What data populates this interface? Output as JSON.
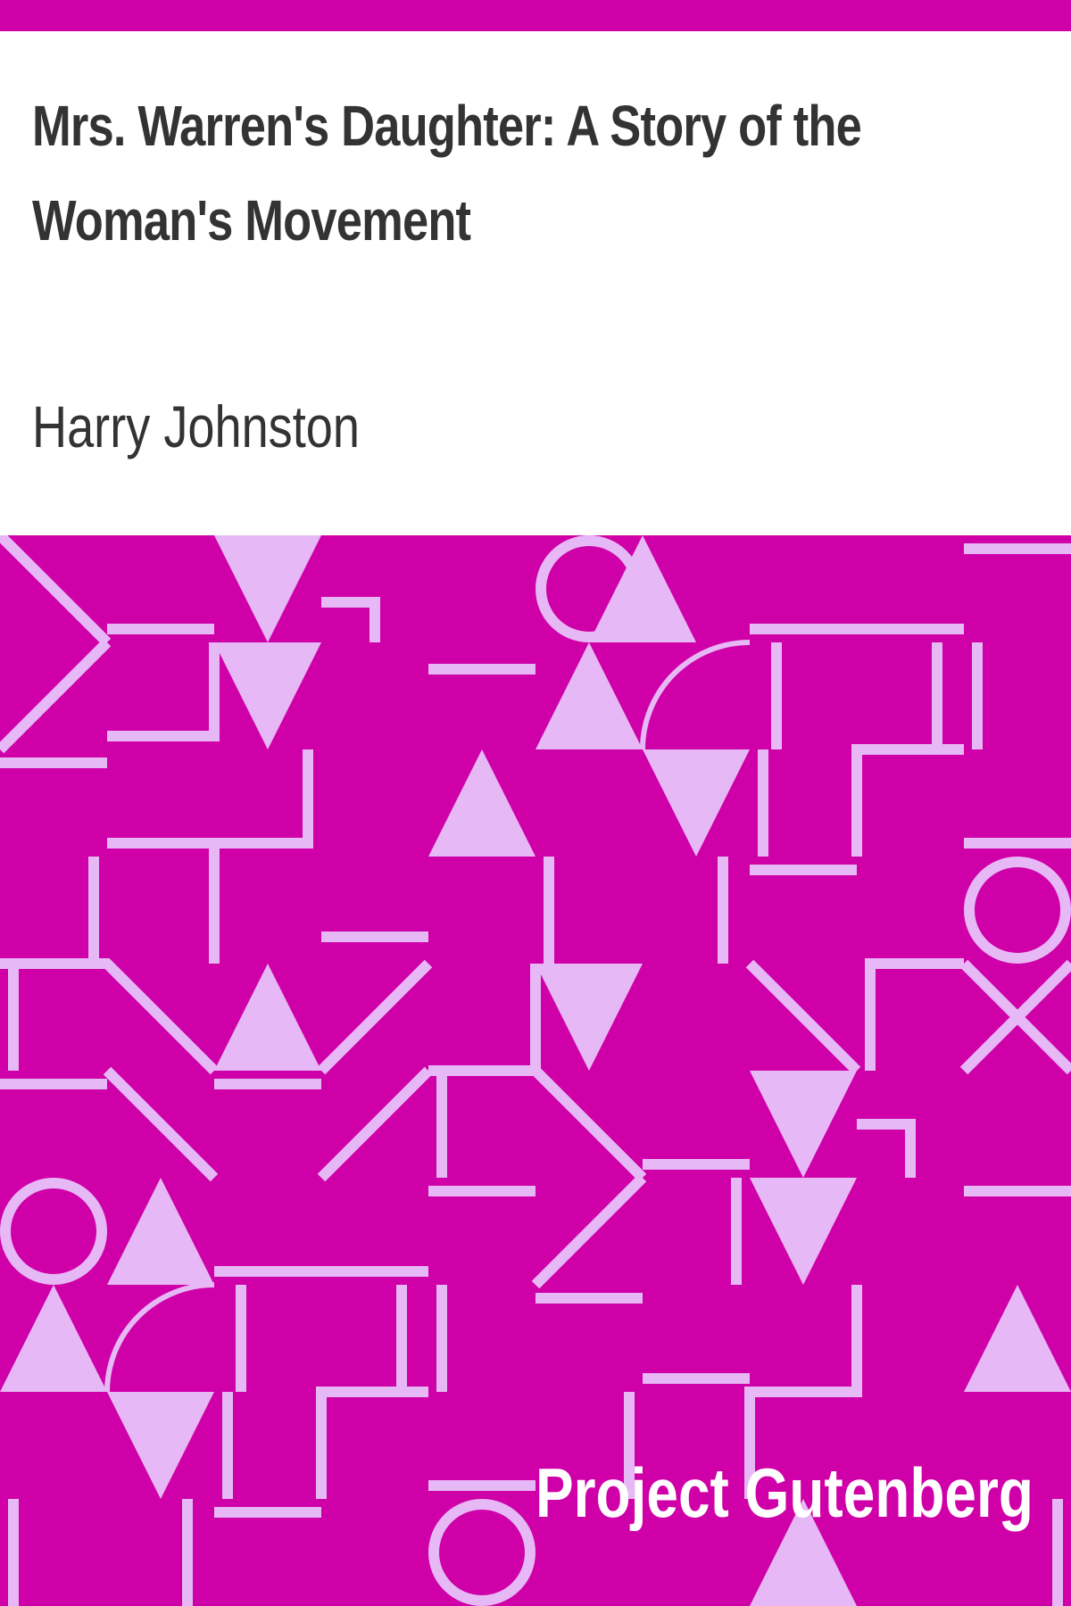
{
  "book": {
    "title_line1": "Mrs. Warren's Daughter: A Story of the",
    "title_line2": "Woman's Movement",
    "author": "Harry Johnston",
    "publisher": "Project Gutenberg"
  },
  "colors": {
    "accent": "#d000a8",
    "pattern_light": "#e6b8f5",
    "text": "#333333",
    "background": "#ffffff"
  }
}
